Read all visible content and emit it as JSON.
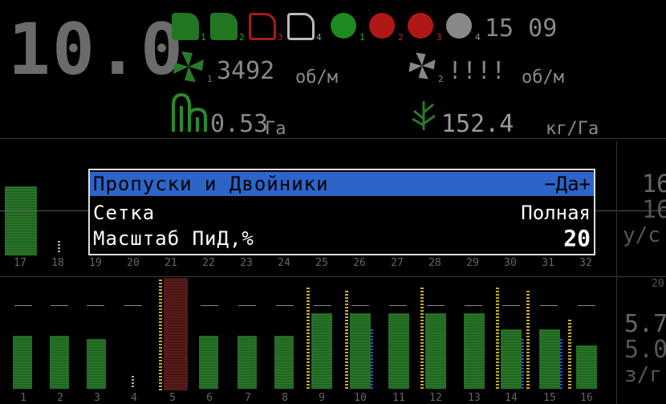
{
  "header": {
    "speed": "10.0",
    "clock": "15 09",
    "fan1": {
      "index": "1",
      "value": "3492",
      "unit": "об/м"
    },
    "fan2": {
      "index": "2",
      "value": "!!!!",
      "unit": "об/м"
    },
    "area": {
      "value": "0.53",
      "unit": "Га"
    },
    "rate": {
      "value": "152.4",
      "unit": "кг/Га"
    },
    "sections": [
      "1",
      "2",
      "3",
      "4"
    ],
    "seeders": [
      "1",
      "2",
      "3",
      "4"
    ]
  },
  "menu": {
    "items": [
      {
        "label": "Пропуски и Двойники",
        "value": "−Да+"
      },
      {
        "label": "Сетка",
        "value": "Полная"
      },
      {
        "label": "Масштаб ПиД,%",
        "value": "20"
      }
    ]
  },
  "top_columns": [
    "17",
    "18",
    "19",
    "20",
    "21",
    "22",
    "23",
    "24",
    "25",
    "26",
    "27",
    "28",
    "29",
    "30",
    "31",
    "32"
  ],
  "bottom_columns": [
    "1",
    "2",
    "3",
    "4",
    "5",
    "6",
    "7",
    "8",
    "9",
    "10",
    "11",
    "12",
    "13",
    "14",
    "15",
    "16"
  ],
  "right_panel": {
    "top_a": "16",
    "top_b": "16",
    "top_unit": "у/с",
    "mid_label": "20",
    "low_a": "5.7",
    "low_b": "5.0",
    "low_unit": "з/г"
  },
  "colors": {
    "selected_row": "#2c64c8",
    "bar_green": "#2f7f2f",
    "alarm_red": "#cc2222"
  }
}
